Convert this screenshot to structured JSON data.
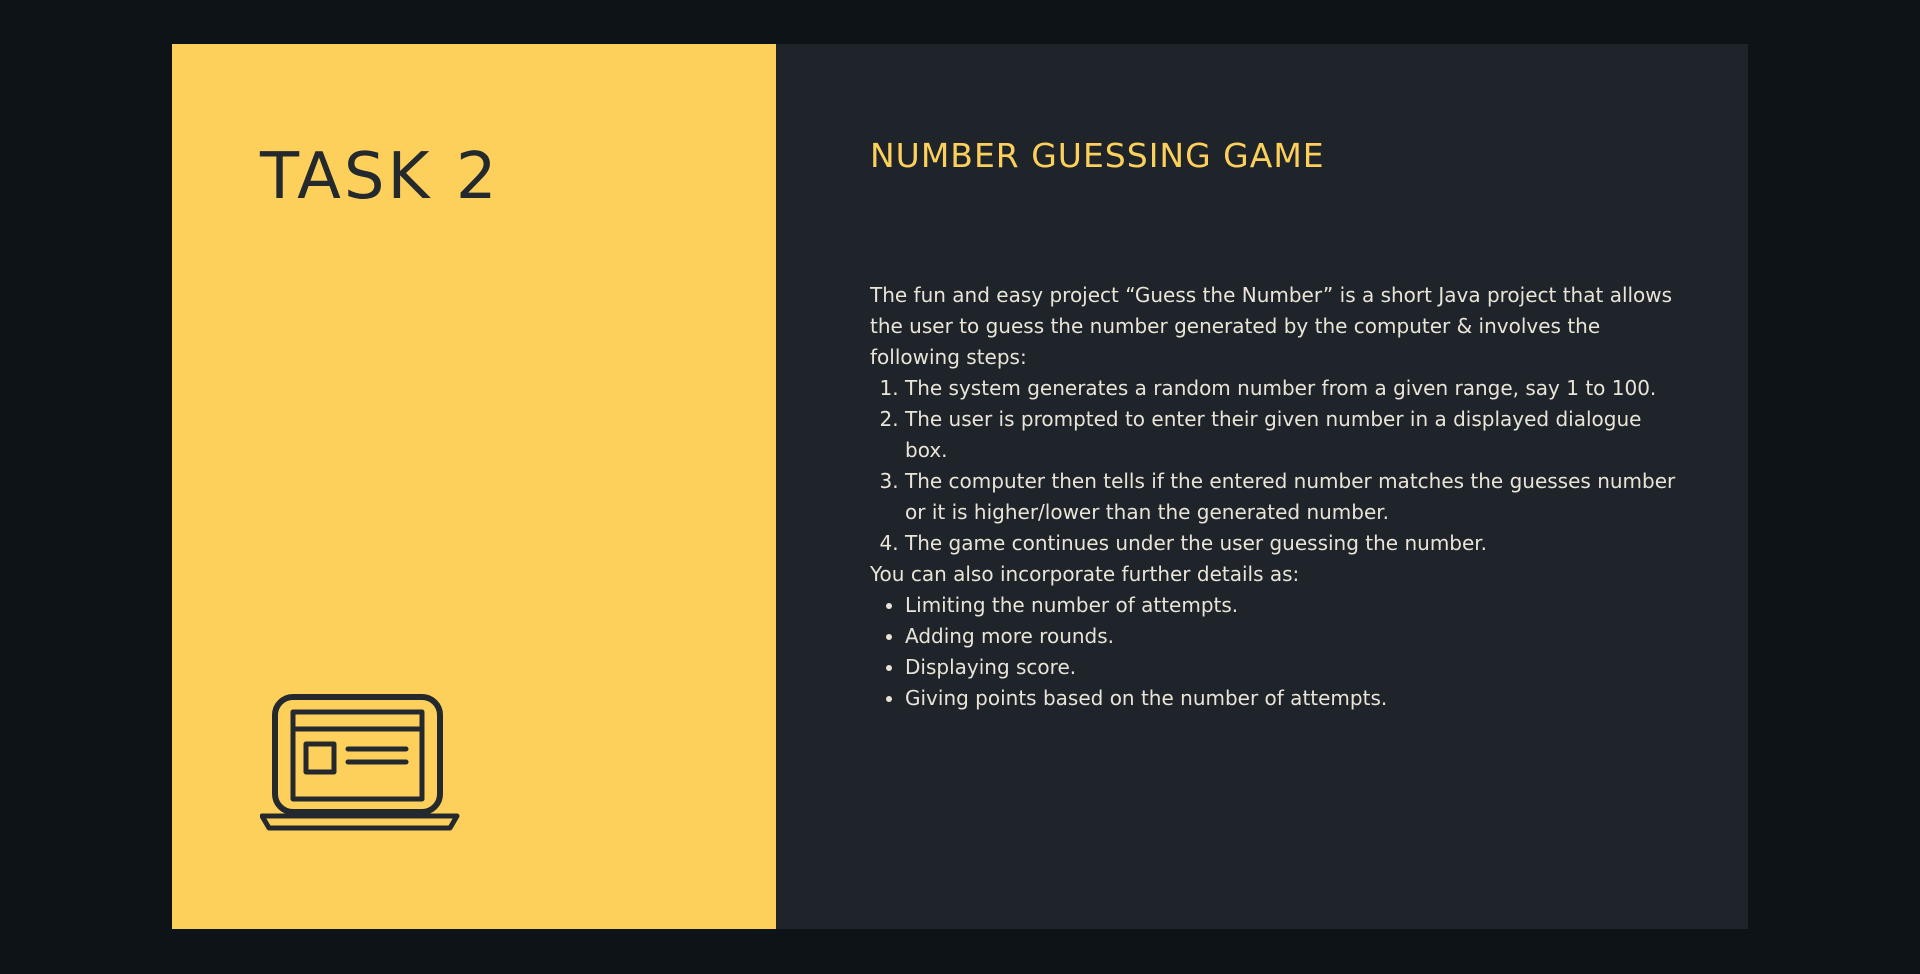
{
  "left": {
    "title": "TASK 2",
    "icon": "laptop-icon"
  },
  "right": {
    "title": "NUMBER GUESSING GAME",
    "intro": "The fun and easy project “Guess the Number” is a short Java project that allows the user to guess the number generated by the computer & involves the following steps:",
    "steps": [
      "The system generates a random number from a given range, say 1 to 100.",
      "The user is prompted to enter their given number in a displayed dialogue box.",
      "The computer then tells if the entered number matches the guesses number or it is higher/lower than the generated number.",
      "The game continues under the user guessing the number."
    ],
    "extras_intro": "You can also incorporate further details as:",
    "extras": [
      "Limiting the number of attempts.",
      "Adding more rounds.",
      "Displaying score.",
      "Giving points based on the number of attempts."
    ]
  },
  "colors": {
    "background": "#0e1317",
    "accent_yellow": "#fdd05b",
    "panel_dark": "#1e2429",
    "text_light": "#e9e4d8",
    "text_dark": "#23292d"
  }
}
